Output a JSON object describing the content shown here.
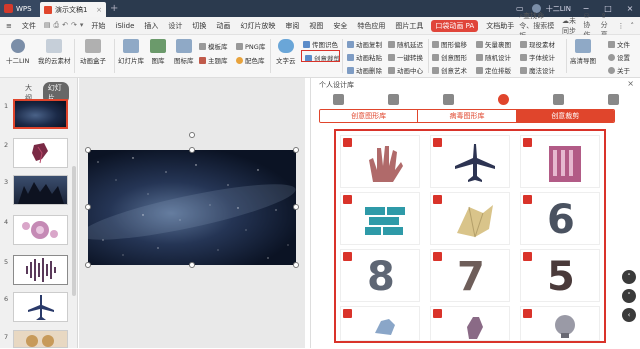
{
  "titlebar": {
    "app_label": "WPS",
    "doc_tab": "演示文稿1",
    "user": "十二LIN"
  },
  "menubar": {
    "file": "文件",
    "items": [
      "开始",
      "iSlide",
      "插入",
      "设计",
      "切换",
      "动画",
      "幻灯片放映",
      "审阅",
      "视图",
      "安全",
      "特色应用",
      "图片工具"
    ],
    "special": "口袋动画 PA",
    "after_special": "文档助手",
    "search": "查找命令、搜索模板",
    "sync": "未同步",
    "collab": "协作",
    "share": "分享"
  },
  "ribbon": {
    "user": "十二LIN",
    "my_cloud": "我的云素材",
    "animation_box": "动画盒子",
    "slide_lib": "幻灯片库",
    "image_lib": "图库",
    "shape_lib": "图标库",
    "template_lib": "模板库",
    "theme_lib": "主题库",
    "png_lib": "PNG库",
    "color_lib": "配色库",
    "text_cloud": "文字云",
    "fuzzy_detect": "传图识色",
    "creative_crop": "创意裁剪",
    "anim_copy": "动画复制",
    "anim_paste": "动画粘贴",
    "anim_delete": "动画删除",
    "random_delay": "随机延迟",
    "one_key_convert": "一键转换",
    "anim_center": "动画中心",
    "shape_split": "图形偏移",
    "creative_shape": "创意图形",
    "creative_art": "创意艺术",
    "vector_resize": "矢量裹图",
    "random_design": "随机设计",
    "locate": "定位排版",
    "avatar_lib": "现役素材",
    "font_stats": "字体统计",
    "wisdom_design": "魔法设计",
    "hq_export": "高清导图",
    "file_r": "文件",
    "settings": "设置",
    "about": "关于"
  },
  "left_panel": {
    "tab_outline": "大纲",
    "tab_slides": "幻灯片",
    "slide_numbers": [
      "1",
      "2",
      "3",
      "4",
      "5",
      "6",
      "7"
    ]
  },
  "right_panel": {
    "title": "个人设计库",
    "tabs": [
      "创意图形库",
      "病毒图形库",
      "创意裁剪"
    ],
    "active_tab": "创意裁剪",
    "digits": [
      "6",
      "8",
      "7",
      "5"
    ]
  },
  "colors": {
    "accent": "#d9332a",
    "titlebar": "#2b3a4e"
  }
}
